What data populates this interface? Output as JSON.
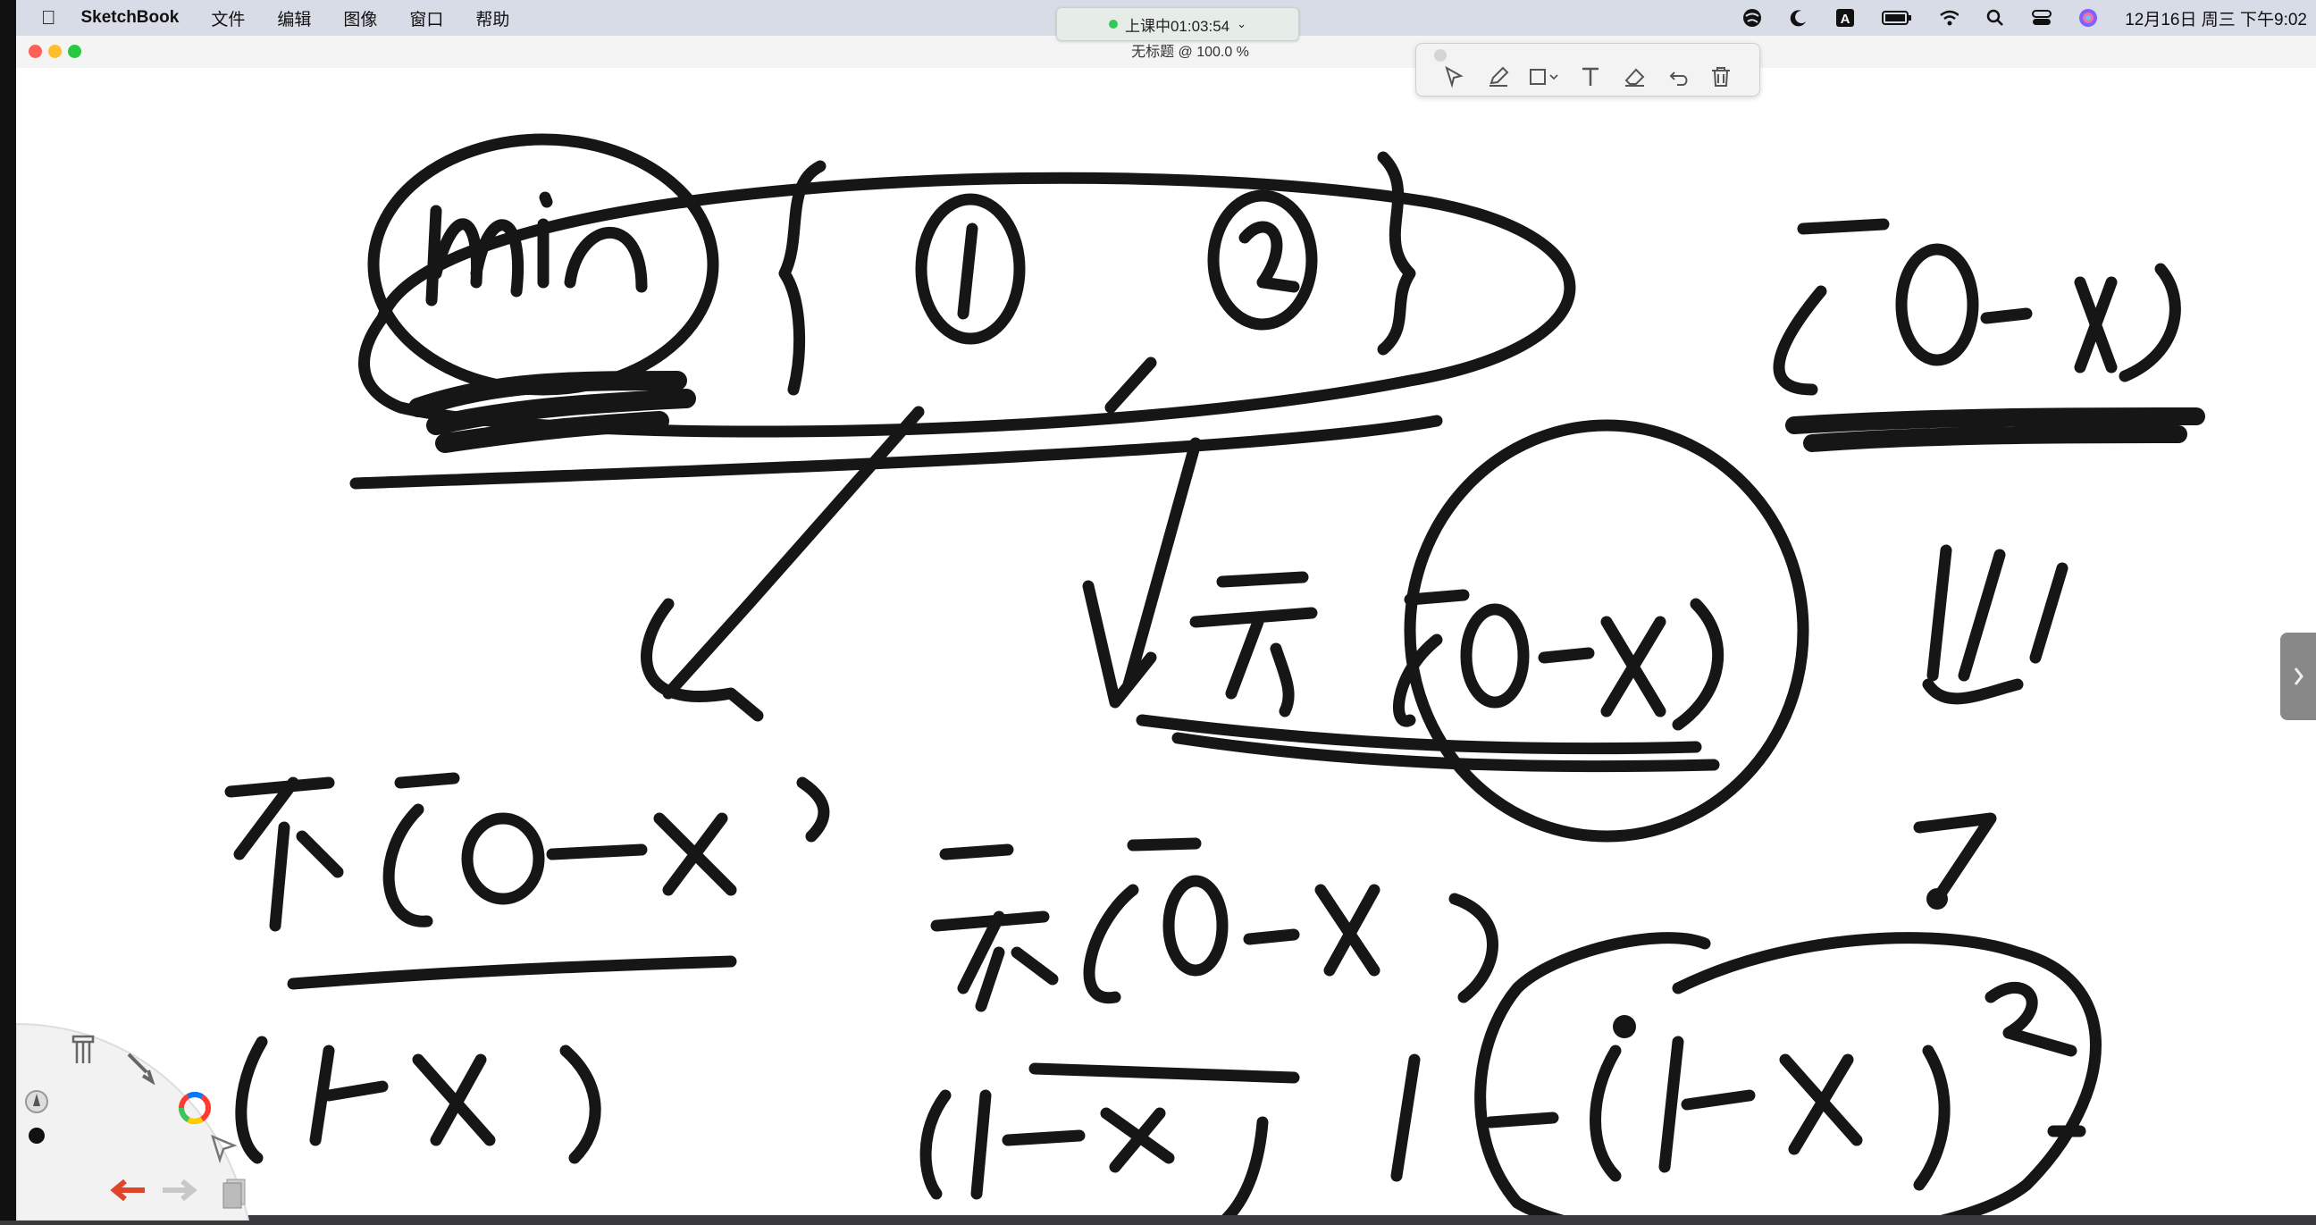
{
  "menubar": {
    "app_name": "SketchBook",
    "items": [
      "文件",
      "编辑",
      "图像",
      "窗口",
      "帮助"
    ],
    "datetime": "12月16日 周三 下午9:02",
    "status_icons": [
      "globe-icon",
      "moon-icon",
      "input-a-icon",
      "battery-icon",
      "wifi-icon",
      "search-icon",
      "control-center-icon",
      "siri-icon"
    ]
  },
  "class_timer": {
    "label": "上课中01:03:54",
    "status_color": "#34c759"
  },
  "window": {
    "title": "无标题 @ 100.0 %"
  },
  "toolbar": {
    "tools": [
      "select-tool-icon",
      "pen-tool-icon",
      "shape-tool-icon",
      "text-tool-icon",
      "eraser-tool-icon",
      "undo-icon",
      "delete-icon"
    ]
  },
  "lagoon": {
    "tools": [
      "brush-library-icon",
      "brush-icon",
      "color-wheel-icon",
      "select-icon",
      "layers-icon",
      "undo-icon",
      "redo-icon"
    ]
  },
  "sketch": {
    "strokes": [
      "min { ① , ② }",
      "[0-x)",
      "不[0-x)",
      "(1-x)",
      "1-(1-x)²",
      "[0-x)",
      "⇓",
      "?"
    ]
  }
}
